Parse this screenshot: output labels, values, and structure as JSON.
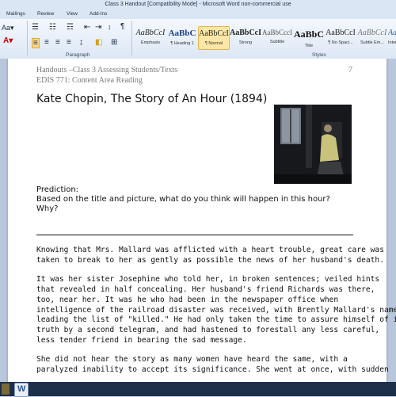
{
  "window": {
    "title": "Class 3 Handout [Compatibility Mode] - Microsoft Word non-commercial use"
  },
  "tabs": [
    "Mailings",
    "Review",
    "View",
    "Add-Ins"
  ],
  "ribbon": {
    "paragraph_group": "Paragraph",
    "styles_group": "Styles",
    "styles": [
      {
        "preview": "AaBbCcI",
        "label": "Emphasis"
      },
      {
        "preview": "AaBbC",
        "label": "¶ Heading 1"
      },
      {
        "preview": "AaBbCcI",
        "label": "¶ Normal"
      },
      {
        "preview": "AaBbCcI",
        "label": "Strong"
      },
      {
        "preview": "AaBbCccI",
        "label": "Subtitle"
      },
      {
        "preview": "AaBbC",
        "label": "Title"
      },
      {
        "preview": "AaBbCcI",
        "label": "¶ No Spaci..."
      },
      {
        "preview": "AaBbCcI",
        "label": "Subtle Em..."
      },
      {
        "preview": "AaBbCcI",
        "label": "Intense E..."
      }
    ]
  },
  "document": {
    "header_line1": "Handouts –Class 3  Assessing Students/Texts",
    "header_line2": "EDIS 771: Content Area Reading",
    "page_number": "7",
    "title": "Kate Chopin, The Story of An Hour (1894)",
    "prediction_label": "Prediction:",
    "prediction_q1": "Based on the title and picture, what do you think will happen in this hour?",
    "prediction_q2": "Why?",
    "para1_l1": "Knowing that Mrs. Mallard was afflicted with a heart trouble, great care was",
    "para1_l2": "taken to break to her as gently as possible the news of her husband's death.",
    "para2_l1": "It was her sister Josephine who told her, in broken sentences; veiled hints",
    "para2_l2": "that revealed in half concealing. Her husband's friend Richards was there,",
    "para2_l3": "too, near her. It was he who had been in the newspaper office when",
    "para2_l4": "intelligence of the railroad disaster was received, with Brently Mallard's name",
    "para2_l5": "leading the list of \"killed.\" He had only taken the time to assure himself of its",
    "para2_l6": "truth by a second telegram, and had hastened to forestall any less careful,",
    "para2_l7": "less tender friend in bearing the sad message.",
    "para3_l1": "She did not hear the story as many women have heard the same, with a",
    "para3_l2": "paralyzed inability to accept its significance. She went at once, with sudden"
  },
  "taskbar": {
    "word_icon": "W"
  }
}
